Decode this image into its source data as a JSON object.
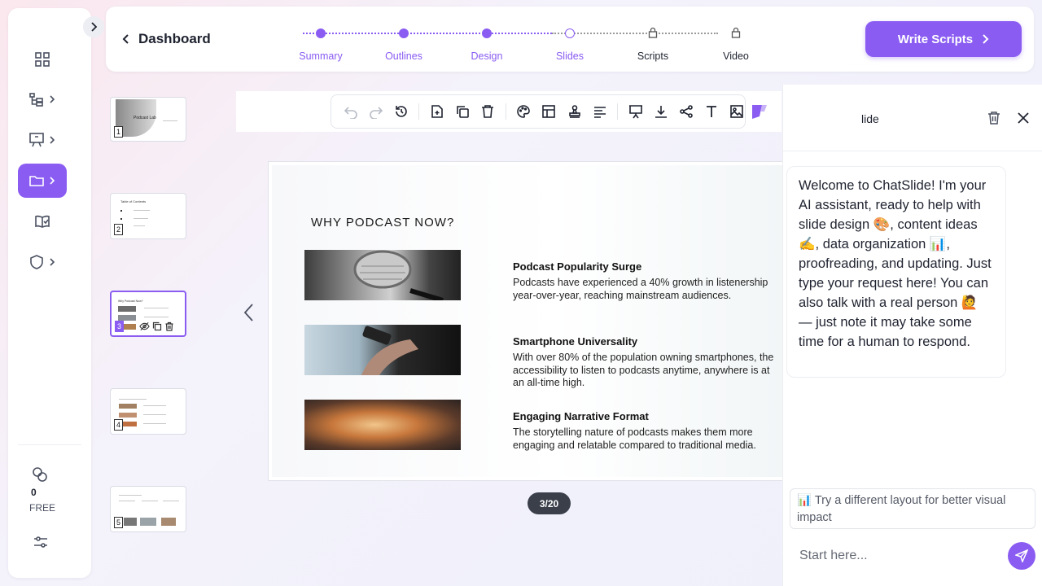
{
  "header": {
    "back_label": "Dashboard",
    "steps": [
      {
        "label": "Summary",
        "state": "done"
      },
      {
        "label": "Outlines",
        "state": "done"
      },
      {
        "label": "Design",
        "state": "done"
      },
      {
        "label": "Slides",
        "state": "current"
      },
      {
        "label": "Scripts",
        "state": "locked"
      },
      {
        "label": "Video",
        "state": "locked"
      }
    ],
    "cta_label": "Write Scripts"
  },
  "sidebar": {
    "items": [
      {
        "icon": "dashboard-grid-icon",
        "has_chevron": false
      },
      {
        "icon": "workflow-tree-icon",
        "has_chevron": true
      },
      {
        "icon": "presentation-screen-icon",
        "has_chevron": true
      },
      {
        "icon": "folder-icon",
        "has_chevron": true,
        "active": true
      },
      {
        "icon": "book-check-icon",
        "has_chevron": false
      },
      {
        "icon": "shield-icon",
        "has_chevron": true
      }
    ],
    "credits_value": "0",
    "plan_label": "FREE"
  },
  "thumbnails": [
    {
      "index": "1",
      "title": "Podcast Lab"
    },
    {
      "index": "2",
      "title": "Table of Contents"
    },
    {
      "index": "3",
      "title": "Why Podcast Now?"
    },
    {
      "index": "4",
      "title": ""
    },
    {
      "index": "5",
      "title": ""
    }
  ],
  "slide": {
    "title": "WHY PODCAST NOW?",
    "points": [
      {
        "heading": "Podcast Popularity Surge",
        "text": "Podcasts have experienced a 40% growth in listenership year-over-year, reaching mainstream audiences."
      },
      {
        "heading": "Smartphone Universality",
        "text": "With over 80% of the population owning smartphones, the accessibility to listen to podcasts anytime, anywhere is at an all-time high."
      },
      {
        "heading": "Engaging Narrative Format",
        "text": "The storytelling nature of podcasts makes them more engaging and relatable compared to traditional media."
      }
    ],
    "page_indicator": "3/20"
  },
  "chat": {
    "title": "lide",
    "welcome": "Welcome to ChatSlide! I'm your AI assistant, ready to help with slide design 🎨, content ideas ✍️, data organization 📊, proofreading, and updating. Just type your request here! You can also talk with a real person 🙋 — just note it may take some time for a human to respond.",
    "suggestion": "📊 Try a different layout for better visual impact",
    "input_placeholder": "Start here..."
  },
  "colors": {
    "accent": "#8a5cf2",
    "pill": "#3a3f4a"
  }
}
